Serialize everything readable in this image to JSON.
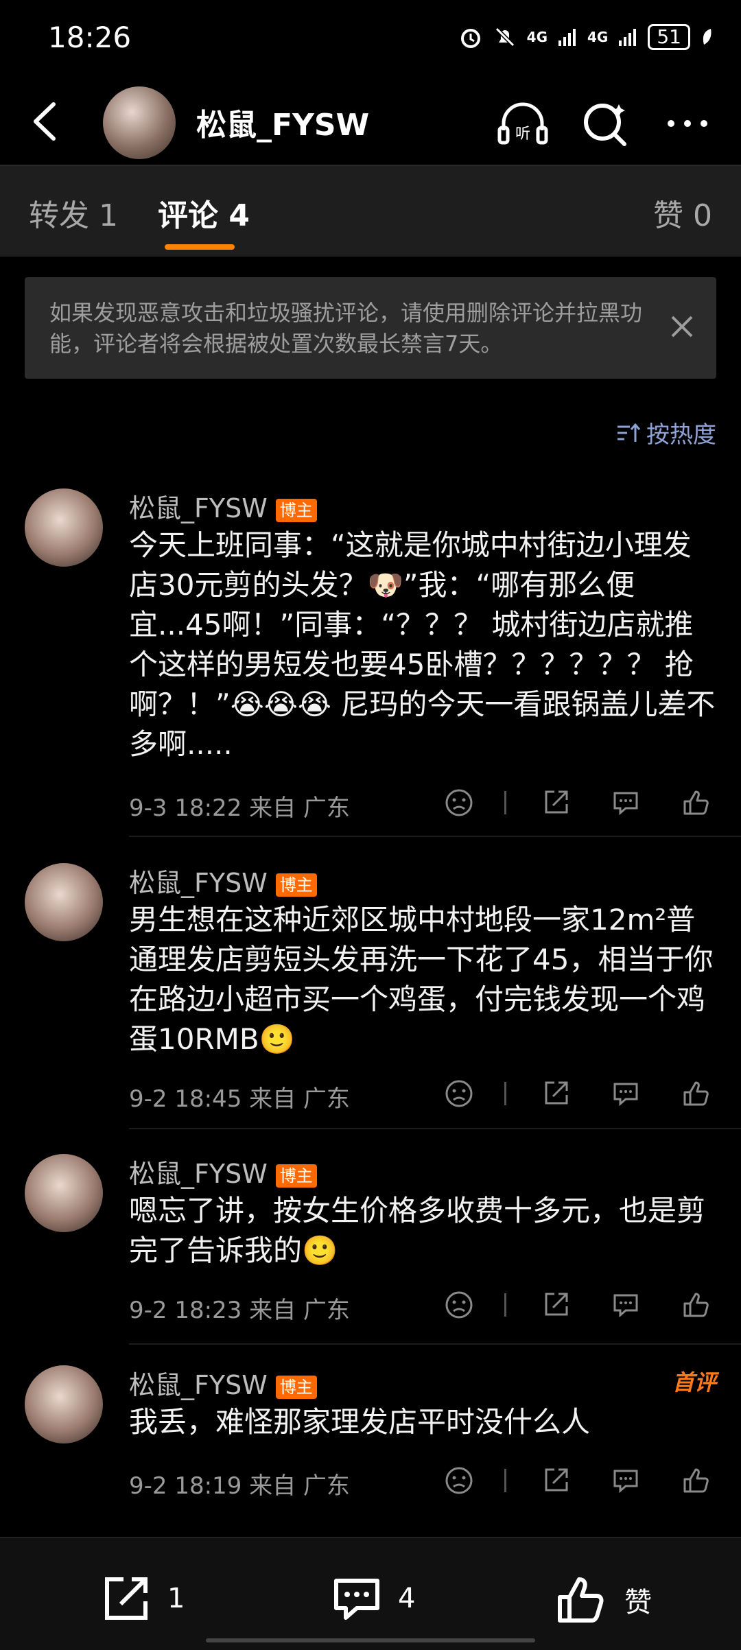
{
  "status_bar": {
    "time": "18:26",
    "network1": "4G",
    "network2": "4G",
    "battery": "51"
  },
  "header": {
    "title": "松鼠_FYSW"
  },
  "tabs": {
    "repost": "转发 1",
    "comments": "评论 4",
    "likes": "赞 0"
  },
  "notice": {
    "text": "如果发现恶意攻击和垃圾骚扰评论，请使用删除评论并拉黑功能，评论者将会根据被处置次数最长禁言7天。"
  },
  "sort": {
    "label": "按热度"
  },
  "comments": [
    {
      "name": "松鼠_FYSW",
      "badge": "博主",
      "text": "今天上班同事：“这就是你城中村街边小理发店30元剪的头发？🐶”我：“哪有那么便宜...45啊！”同事：“？？？ 城村街边店就推个这样的男短发也要45卧槽？？？？？？ 抢啊？！”😭😭😭 尼玛的今天一看跟锅盖儿差不多啊.....",
      "meta": "9-3 18:22  来自 广东"
    },
    {
      "name": "松鼠_FYSW",
      "badge": "博主",
      "text": "男生想在这种近郊区城中村地段一家12m²普通理发店剪短头发再洗一下花了45，相当于你在路边小超市买一个鸡蛋，付完钱发现一个鸡蛋10RMB🙂",
      "meta": "9-2 18:45  来自 广东"
    },
    {
      "name": "松鼠_FYSW",
      "badge": "博主",
      "text": "嗯忘了讲，按女生价格多收费十多元，也是剪完了告诉我的🙂",
      "meta": "9-2 18:23  来自 广东"
    },
    {
      "name": "松鼠_FYSW",
      "badge": "博主",
      "first": "首评",
      "text": "我丢，难怪那家理发店平时没什么人",
      "meta": "9-2 18:19  来自 广东"
    }
  ],
  "bottom_bar": {
    "repost_count": "1",
    "comment_count": "4",
    "like_label": "赞"
  }
}
